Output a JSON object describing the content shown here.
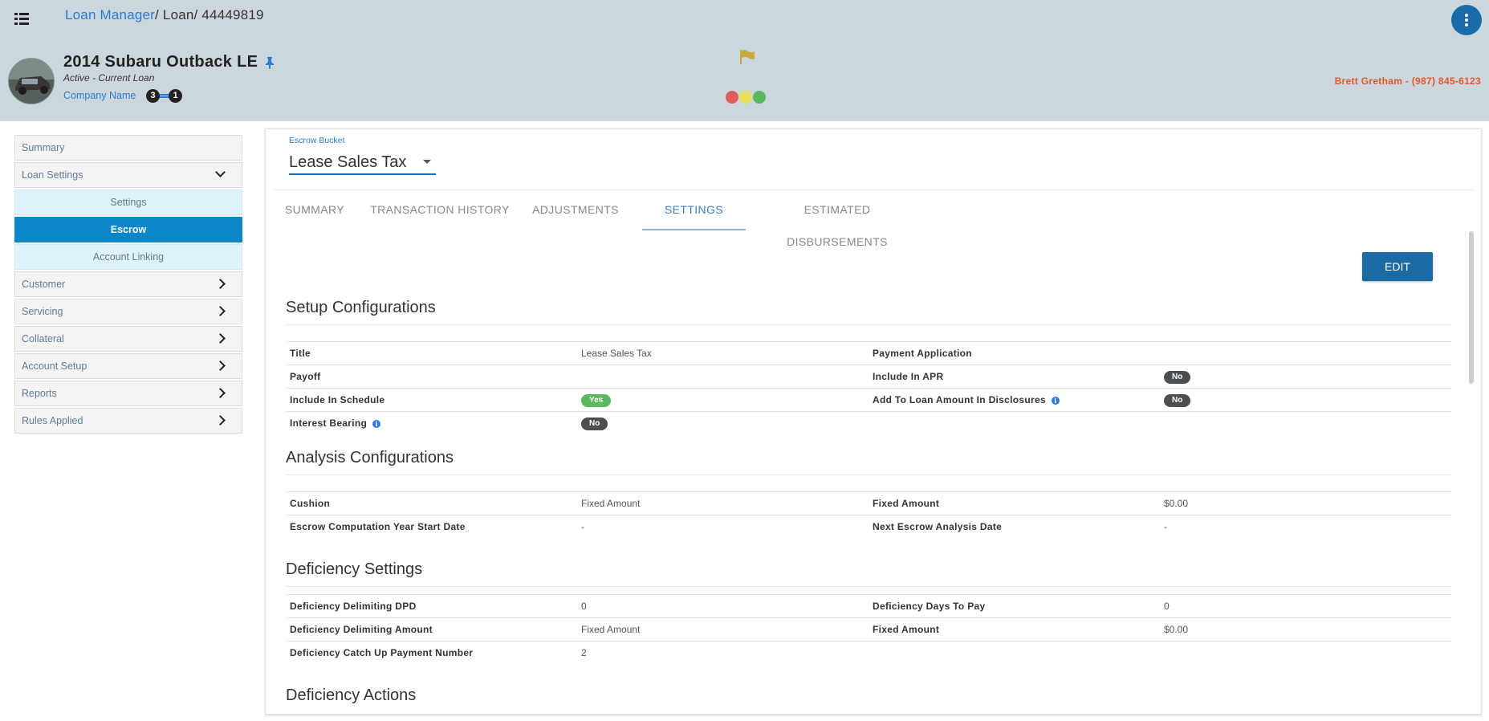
{
  "breadcrumb": {
    "root": "Loan Manager",
    "sep": "/",
    "level2": "Loan",
    "loan_id": "44449819"
  },
  "header": {
    "title": "2014 Subaru Outback LE",
    "status": "Active - Current Loan",
    "company": "Company Name",
    "badge_left": "3",
    "badge_right": "1",
    "contact": "Brett Gretham - (987) 845-6123",
    "colors": {
      "flag": "#c9a93a",
      "red": "#e05c5c",
      "yellow": "#e6e05a",
      "green": "#5cb85c",
      "accent": "#1a6ca8"
    }
  },
  "sidebar": {
    "items": [
      {
        "label": "Summary"
      },
      {
        "label": "Loan Settings"
      },
      {
        "label": "Settings"
      },
      {
        "label": "Escrow"
      },
      {
        "label": "Account Linking"
      },
      {
        "label": "Customer"
      },
      {
        "label": "Servicing"
      },
      {
        "label": "Collateral"
      },
      {
        "label": "Account Setup"
      },
      {
        "label": "Reports"
      },
      {
        "label": "Rules Applied"
      }
    ]
  },
  "bucket": {
    "label": "Escrow Bucket",
    "value": "Lease Sales Tax"
  },
  "tabs": [
    "SUMMARY",
    "TRANSACTION HISTORY",
    "ADJUSTMENTS",
    "SETTINGS",
    "ESTIMATED DISBURSEMENTS"
  ],
  "edit_label": "EDIT",
  "setup": {
    "title": "Setup Configurations",
    "rows": [
      [
        "Title",
        "Lease Sales Tax",
        "Payment Application",
        ""
      ],
      [
        "Payoff",
        "",
        "Include In APR",
        "No"
      ],
      [
        "Include In Schedule",
        "Yes",
        "Add To Loan Amount In Disclosures",
        "No"
      ],
      [
        "Interest Bearing",
        "No",
        "",
        ""
      ]
    ]
  },
  "analysis": {
    "title": "Analysis Configurations",
    "rows": [
      [
        "Cushion",
        "Fixed Amount",
        "Fixed Amount",
        "$0.00"
      ],
      [
        "Escrow Computation Year Start Date",
        "-",
        "Next Escrow Analysis Date",
        "-"
      ]
    ]
  },
  "deficiency": {
    "title": "Deficiency Settings",
    "rows": [
      [
        "Deficiency Delimiting DPD",
        "0",
        "Deficiency Days To Pay",
        "0"
      ],
      [
        "Deficiency Delimiting Amount",
        "Fixed Amount",
        "Fixed Amount",
        "$0.00"
      ],
      [
        "Deficiency Catch Up Payment Number",
        "2",
        "",
        ""
      ]
    ]
  },
  "actions": {
    "title": "Deficiency Actions"
  },
  "info_glyph": "i"
}
